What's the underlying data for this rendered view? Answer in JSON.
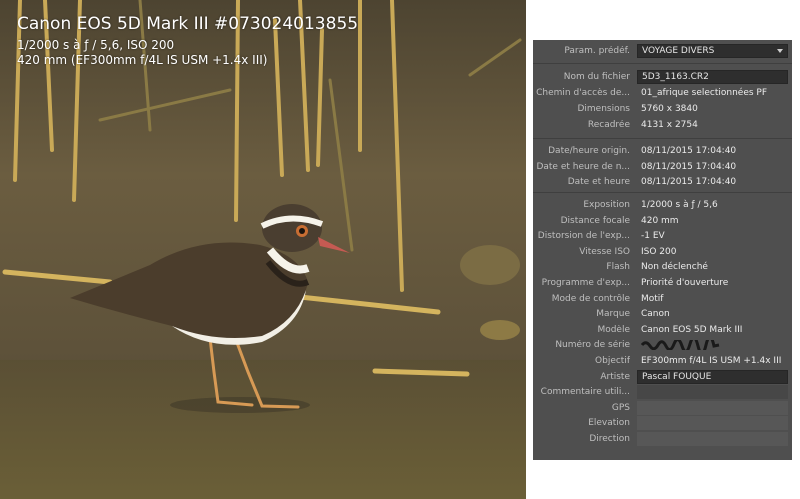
{
  "photo": {
    "title": "Canon EOS 5D Mark III #073024013855",
    "line1": "1/2000 s à ƒ / 5,6, ISO 200",
    "line2": "420 mm (EF300mm f/4L IS USM +1.4x III)"
  },
  "panel": {
    "preset": {
      "label": "Param. prédéf.",
      "value": "VOYAGE DIVERS"
    },
    "file": [
      {
        "label": "Nom du fichier",
        "value": "5D3_1163.CR2",
        "boxed": true
      },
      {
        "label": "Chemin d'accès de...",
        "value": "01_afrique selectionnées PF"
      },
      {
        "label": "Dimensions",
        "value": "5760 x 3840"
      },
      {
        "label": "Recadrée",
        "value": "4131 x 2754"
      }
    ],
    "dates": [
      {
        "label": "Date/heure origin.",
        "value": "08/11/2015 17:04:40"
      },
      {
        "label": "Date et heure de n...",
        "value": "08/11/2015 17:04:40"
      },
      {
        "label": "Date et heure",
        "value": "08/11/2015 17:04:40"
      }
    ],
    "exif": [
      {
        "label": "Exposition",
        "value": "1/2000 s à ƒ / 5,6"
      },
      {
        "label": "Distance focale",
        "value": "420 mm"
      },
      {
        "label": "Distorsion de l'exp...",
        "value": "-1 EV"
      },
      {
        "label": "Vitesse ISO",
        "value": "ISO 200"
      },
      {
        "label": "Flash",
        "value": "Non déclenché"
      },
      {
        "label": "Programme d'exp...",
        "value": "Priorité d'ouverture"
      },
      {
        "label": "Mode de contrôle",
        "value": "Motif"
      },
      {
        "label": "Marque",
        "value": "Canon"
      },
      {
        "label": "Modèle",
        "value": "Canon EOS 5D Mark III"
      },
      {
        "label": "Numéro de série",
        "value": "",
        "redacted": true
      },
      {
        "label": "Objectif",
        "value": "EF300mm f/4L IS USM +1.4x III"
      },
      {
        "label": "Artiste",
        "value": "Pascal FOUQUE",
        "boxed": true
      },
      {
        "label": "Commentaire utili...",
        "value": "",
        "boxed": true,
        "empty": true
      },
      {
        "label": "GPS",
        "value": "",
        "empty": true
      },
      {
        "label": "Élevation",
        "value": "",
        "empty": true
      },
      {
        "label": "Direction",
        "value": "",
        "empty": true
      }
    ]
  }
}
